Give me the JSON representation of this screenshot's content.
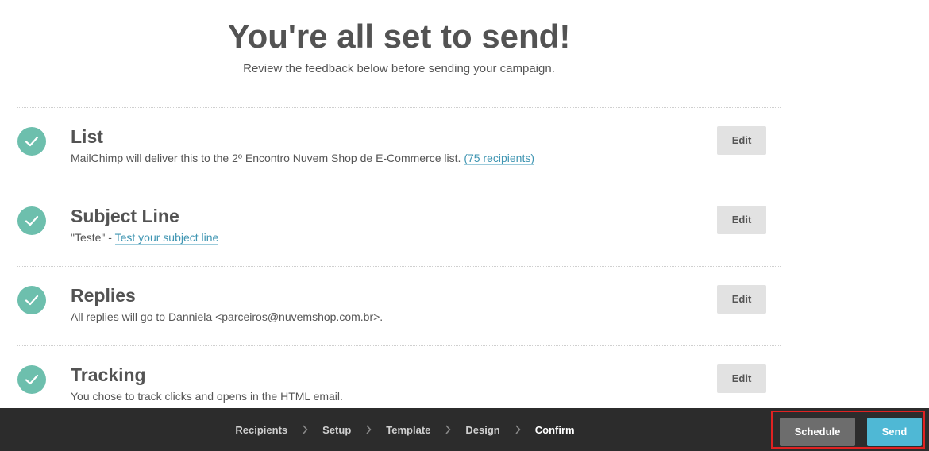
{
  "header": {
    "title": "You're all set to send!",
    "subtitle": "Review the feedback below before sending your campaign."
  },
  "checklist": [
    {
      "title": "List",
      "text": "MailChimp will deliver this to the 2º Encontro Nuvem Shop de E-Commerce list. ",
      "link": "(75 recipients)",
      "suffix": "",
      "edit_label": "Edit",
      "status_icon": "check-circle-icon"
    },
    {
      "title": "Subject Line",
      "text": "\"Teste\" - ",
      "link": "Test your subject line",
      "suffix": "",
      "edit_label": "Edit",
      "status_icon": "check-circle-icon"
    },
    {
      "title": "Replies",
      "text": "All replies will go to Danniela <parceiros@nuvemshop.com.br>.",
      "link": "",
      "suffix": "",
      "edit_label": "Edit",
      "status_icon": "check-circle-icon"
    },
    {
      "title": "Tracking",
      "text": "You chose to track clicks and opens in the HTML email.",
      "link": "",
      "suffix": "",
      "edit_label": "Edit",
      "status_icon": "check-circle-icon"
    }
  ],
  "footer": {
    "steps": [
      "Recipients",
      "Setup",
      "Template",
      "Design",
      "Confirm"
    ],
    "active_step": "Confirm",
    "schedule_label": "Schedule",
    "send_label": "Send"
  },
  "colors": {
    "check": "#6dbfad",
    "link": "#3f95b2",
    "send": "#4fb8d5",
    "schedule": "#6d6d6d",
    "footer_bg": "#2c2c2c",
    "highlight": "#e02222"
  }
}
